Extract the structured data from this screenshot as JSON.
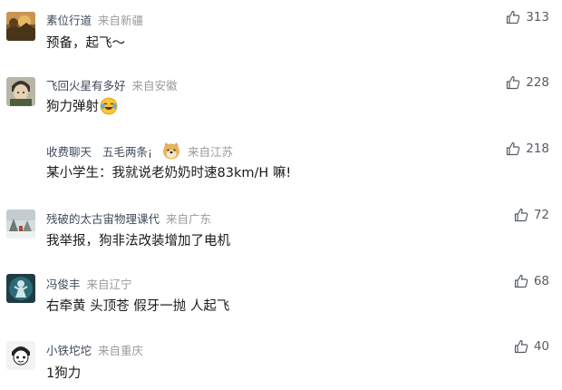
{
  "comments": [
    {
      "username": "素位行道",
      "location": "来自新疆",
      "text": "预备，起飞～",
      "likes": "313",
      "avatar_icon": "avatar-sunset-tree-icon"
    },
    {
      "username": "飞回火星有多好",
      "location": "来自安徽",
      "text": "狗力弹射",
      "likes": "228",
      "avatar_icon": "avatar-anime-character-icon",
      "emoji": "laughing-tears-emoji-icon"
    },
    {
      "username": "收费聊天",
      "extra": "五毛两条¡",
      "location": "来自江苏",
      "text": "某小学生：我就说老奶奶时速83km/H 嘛!",
      "likes": "218",
      "avatar_icon": "none",
      "badge_icon": "doge-emoji-icon"
    },
    {
      "username": "残破的太古宙物理课代",
      "location": "来自广东",
      "text": "我举报，狗非法改装增加了电机",
      "likes": "72",
      "avatar_icon": "avatar-winter-scene-icon"
    },
    {
      "username": "冯俊丰",
      "location": "来自辽宁",
      "text": "右牵黄 头顶苍 假牙一抛 人起飞",
      "likes": "68",
      "avatar_icon": "avatar-cyan-character-icon"
    },
    {
      "username": "小铁坨坨",
      "location": "来自重庆",
      "text": "1狗力",
      "likes": "40",
      "avatar_icon": "avatar-manga-face-icon"
    }
  ],
  "colors": {
    "username": "#3f4a5a",
    "location": "#9a9a9a",
    "text": "#1a1a1a",
    "likes": "#555c66"
  }
}
